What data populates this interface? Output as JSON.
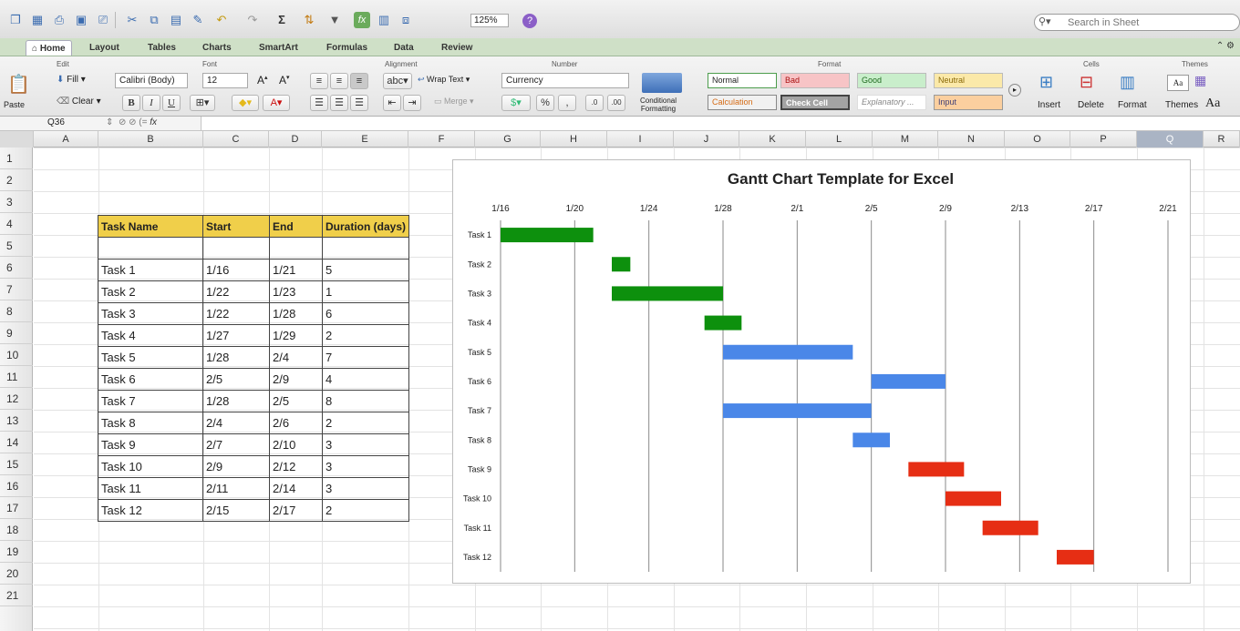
{
  "toolbar": {
    "zoom": "125%",
    "search_placeholder": "Search in Sheet"
  },
  "tabs": [
    "Home",
    "Layout",
    "Tables",
    "Charts",
    "SmartArt",
    "Formulas",
    "Data",
    "Review"
  ],
  "ribbon": {
    "groups": {
      "edit": "Edit",
      "font": "Font",
      "alignment": "Alignment",
      "number": "Number",
      "format": "Format",
      "cells": "Cells",
      "themes": "Themes"
    },
    "paste": "Paste",
    "fill": "Fill",
    "clear": "Clear",
    "font_name": "Calibri (Body)",
    "font_size": "12",
    "bold": "B",
    "italic": "I",
    "underline": "U",
    "wrap_text": "Wrap Text",
    "merge": "Merge",
    "abc": "abc",
    "number_format": "Currency",
    "percent": "%",
    "comma": ",",
    "conditional_formatting": "Conditional Formatting",
    "styles": {
      "normal": "Normal",
      "bad": "Bad",
      "good": "Good",
      "neutral": "Neutral",
      "calculation": "Calculation",
      "check_cell": "Check Cell",
      "explanatory": "Explanatory ...",
      "input": "Input"
    },
    "insert": "Insert",
    "delete": "Delete",
    "format": "Format",
    "themes": "Themes",
    "aa": "Aa"
  },
  "formula_bar": {
    "name_box": "Q36",
    "fx": "fx"
  },
  "columns": [
    "A",
    "B",
    "C",
    "D",
    "E",
    "F",
    "G",
    "H",
    "I",
    "J",
    "K",
    "L",
    "M",
    "N",
    "O",
    "P",
    "Q",
    "R"
  ],
  "selected_column": "Q",
  "rows": [
    "1",
    "2",
    "3",
    "4",
    "5",
    "6",
    "7",
    "8",
    "9",
    "10",
    "11",
    "12",
    "13",
    "14",
    "15",
    "16",
    "17",
    "18",
    "19",
    "20",
    "21"
  ],
  "table": {
    "headers": [
      "Task Name",
      "Start",
      "End",
      "Duration (days)"
    ],
    "rows": [
      [
        "Task 1",
        "1/16",
        "1/21",
        "5"
      ],
      [
        "Task 2",
        "1/22",
        "1/23",
        "1"
      ],
      [
        "Task 3",
        "1/22",
        "1/28",
        "6"
      ],
      [
        "Task 4",
        "1/27",
        "1/29",
        "2"
      ],
      [
        "Task 5",
        "1/28",
        "2/4",
        "7"
      ],
      [
        "Task 6",
        "2/5",
        "2/9",
        "4"
      ],
      [
        "Task 7",
        "1/28",
        "2/5",
        "8"
      ],
      [
        "Task 8",
        "2/4",
        "2/6",
        "2"
      ],
      [
        "Task 9",
        "2/7",
        "2/10",
        "3"
      ],
      [
        "Task 10",
        "2/9",
        "2/12",
        "3"
      ],
      [
        "Task 11",
        "2/11",
        "2/14",
        "3"
      ],
      [
        "Task 12",
        "2/15",
        "2/17",
        "2"
      ]
    ]
  },
  "colors": {
    "green": "#0d900d",
    "blue": "#4a87e8",
    "red": "#e62e14",
    "header_fill": "#f0cf4a",
    "ribbon_tab": "#cfe0c7"
  },
  "chart_data": {
    "type": "bar",
    "orientation": "horizontal-gantt",
    "title": "Gantt Chart Template for Excel",
    "categories": [
      "Task 1",
      "Task 2",
      "Task 3",
      "Task 4",
      "Task 5",
      "Task 6",
      "Task 7",
      "Task 8",
      "Task 9",
      "Task 10",
      "Task 11",
      "Task 12"
    ],
    "x_ticks": [
      "1/16",
      "1/20",
      "1/24",
      "1/28",
      "2/1",
      "2/5",
      "2/9",
      "2/13",
      "2/17",
      "2/21"
    ],
    "xlim": [
      "1/16",
      "2/21"
    ],
    "grid": "vertical",
    "series": [
      {
        "color": "#0d900d",
        "bars": [
          {
            "task": "Task 1",
            "start": "1/16",
            "end": "1/21"
          },
          {
            "task": "Task 2",
            "start": "1/22",
            "end": "1/23"
          },
          {
            "task": "Task 3",
            "start": "1/22",
            "end": "1/28"
          },
          {
            "task": "Task 4",
            "start": "1/27",
            "end": "1/29"
          }
        ]
      },
      {
        "color": "#4a87e8",
        "bars": [
          {
            "task": "Task 5",
            "start": "1/28",
            "end": "2/4"
          },
          {
            "task": "Task 6",
            "start": "2/5",
            "end": "2/9"
          },
          {
            "task": "Task 7",
            "start": "1/28",
            "end": "2/5"
          },
          {
            "task": "Task 8",
            "start": "2/4",
            "end": "2/6"
          }
        ]
      },
      {
        "color": "#e62e14",
        "bars": [
          {
            "task": "Task 9",
            "start": "2/7",
            "end": "2/10"
          },
          {
            "task": "Task 10",
            "start": "2/9",
            "end": "2/12"
          },
          {
            "task": "Task 11",
            "start": "2/11",
            "end": "2/14"
          },
          {
            "task": "Task 12",
            "start": "2/15",
            "end": "2/17"
          }
        ]
      }
    ]
  }
}
